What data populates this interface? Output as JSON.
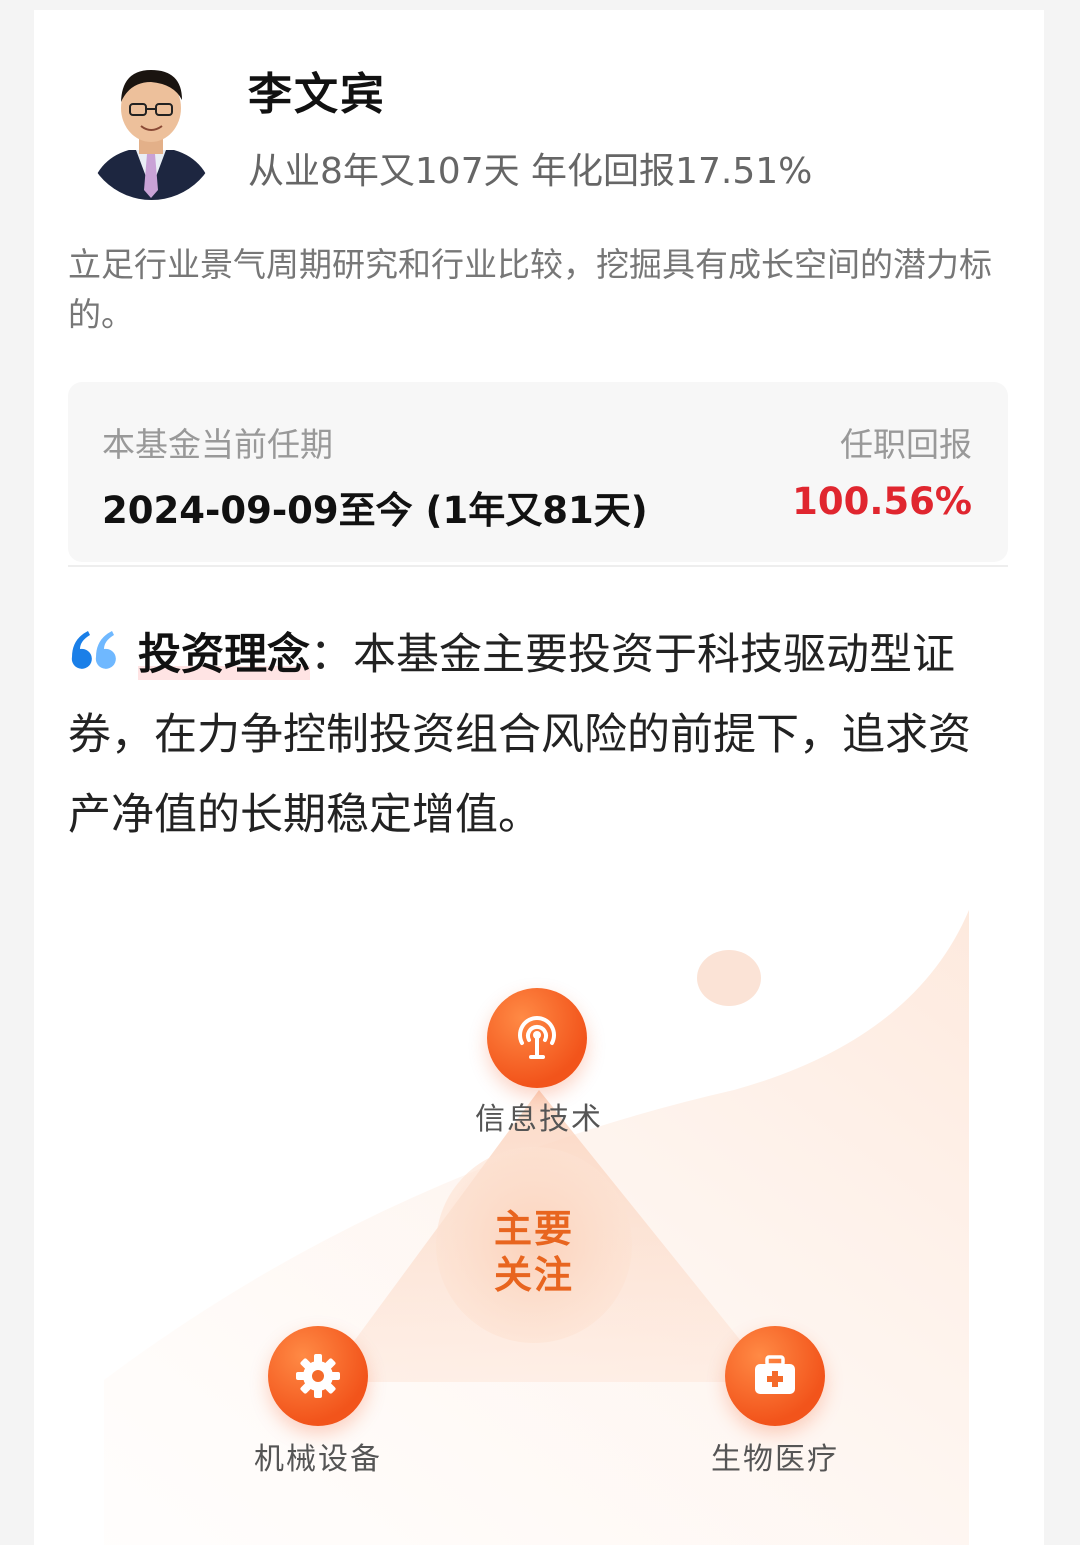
{
  "manager": {
    "name": "李文宾",
    "tenure_text": "从业8年又107天 年化回报17.51%",
    "description": "立足行业景气周期研究和行业比较，挖掘具有成长空间的潜力标的。"
  },
  "term": {
    "label": "本基金当前任期",
    "value": "2024-09-09至今 (1年又81天)",
    "return_label": "任职回报",
    "return_value": "100.56%"
  },
  "philosophy": {
    "title": "投资理念",
    "separator": "：",
    "text": "本基金主要投资于科技驱动型证券，在力争控制投资组合风险的前提下，追求资产净值的长期稳定增值。"
  },
  "focus": {
    "center_label_line1": "主要",
    "center_label_line2": "关注",
    "items": [
      {
        "label": "信息技术",
        "icon": "signal-tower-icon"
      },
      {
        "label": "机械设备",
        "icon": "gear-icon"
      },
      {
        "label": "生物医疗",
        "icon": "medical-kit-icon"
      }
    ]
  },
  "colors": {
    "accent": "#f2541b",
    "return_red": "#e0262f",
    "center_text": "#e8651f"
  }
}
